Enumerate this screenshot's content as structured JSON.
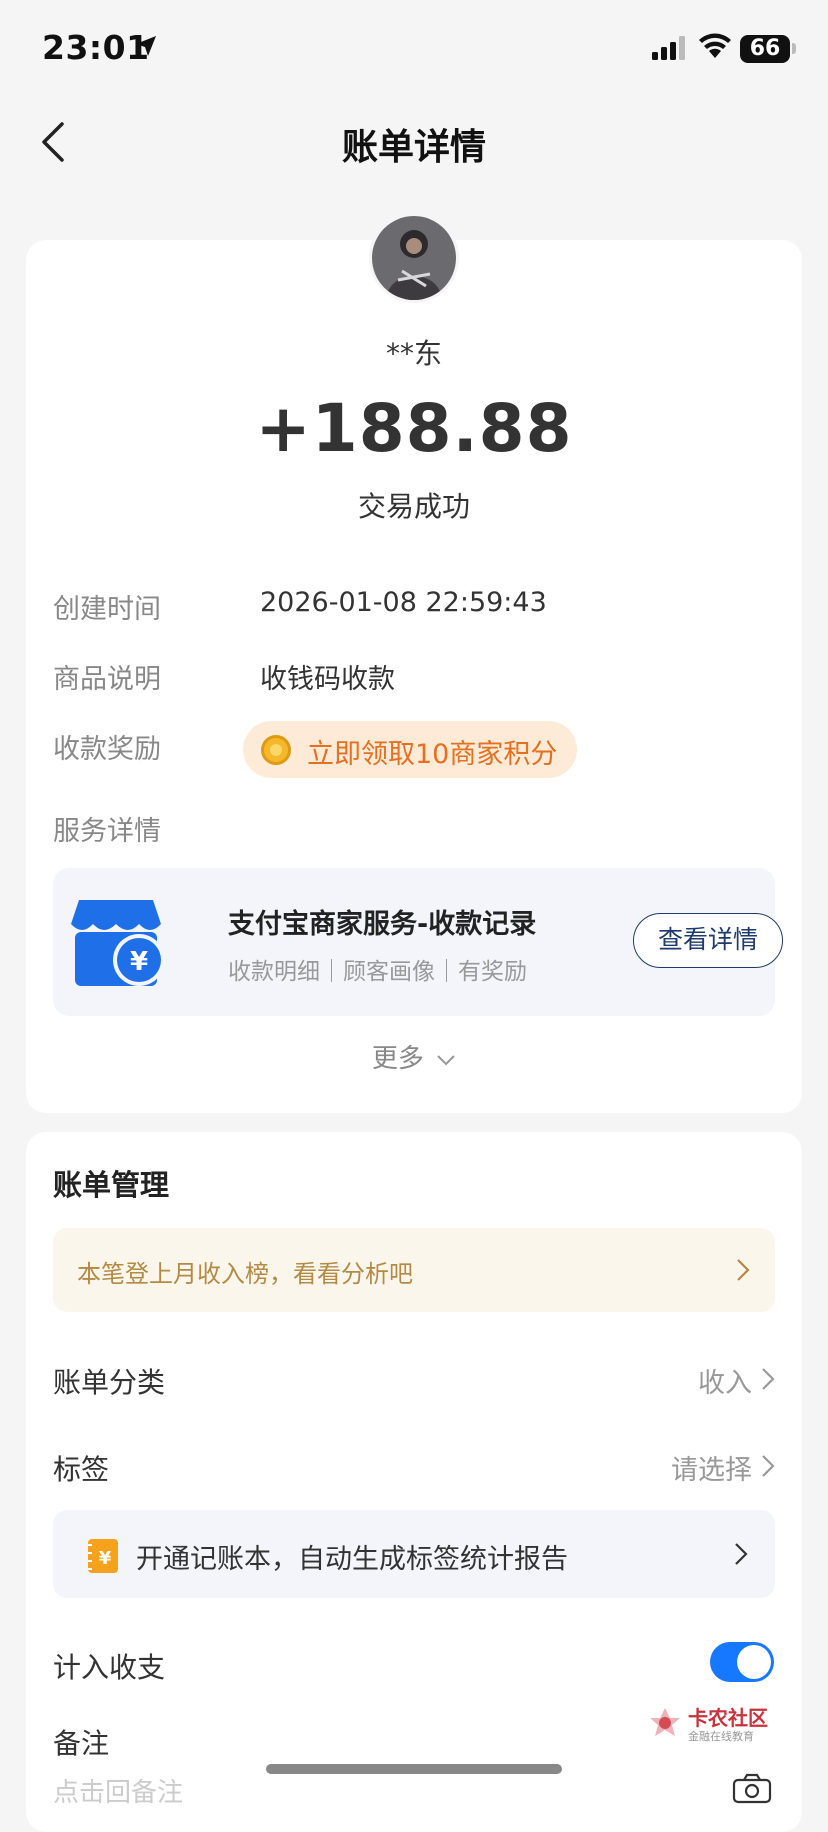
{
  "status_bar": {
    "time": "23:01",
    "battery": "66"
  },
  "nav": {
    "title": "账单详情"
  },
  "payer": {
    "name": "**东"
  },
  "transaction": {
    "amount": "+188.88",
    "status": "交易成功"
  },
  "details": {
    "created_label": "创建时间",
    "created_value": "2026-01-08 22:59:43",
    "product_label": "商品说明",
    "product_value": "收钱码收款",
    "reward_label": "收款奖励",
    "reward_value": "立即领取10商家积分",
    "service_label": "服务详情"
  },
  "service": {
    "title": "支付宝商家服务-收款记录",
    "tags": "收款明细｜顾客画像｜有奖励",
    "button": "查看详情"
  },
  "more": {
    "label": "更多"
  },
  "management": {
    "title": "账单管理",
    "analysis_banner": "本笔登上月收入榜，看看分析吧",
    "category_label": "账单分类",
    "category_value": "收入",
    "tag_label": "标签",
    "tag_value": "请选择",
    "ledger_banner": "开通记账本，自动生成标签统计报告",
    "include_label": "计入收支",
    "include_on": true,
    "note_label": "备注",
    "note_placeholder": "点击回备注"
  },
  "watermark": {
    "title": "卡农社区",
    "subtitle": "金融在线教育"
  },
  "colors": {
    "accent": "#1677ff",
    "reward_text": "#e5701f",
    "reward_bg": "#fdebd8",
    "analysis_text": "#b48a45",
    "button_border": "#1f3a6e"
  }
}
